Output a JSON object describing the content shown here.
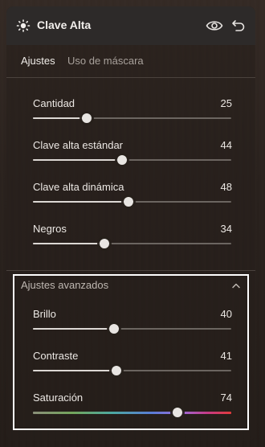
{
  "header": {
    "title": "Clave Alta",
    "icon": "sun-icon"
  },
  "tabs": [
    {
      "label": "Ajustes",
      "active": true
    },
    {
      "label": "Uso de máscara",
      "active": false
    }
  ],
  "sliders": [
    {
      "label": "Cantidad",
      "value": "25",
      "position": 0.27
    },
    {
      "label": "Clave alta estándar",
      "value": "44",
      "position": 0.45
    },
    {
      "label": "Clave alta dinámica",
      "value": "48",
      "position": 0.48
    },
    {
      "label": "Negros",
      "value": "34",
      "position": 0.36
    }
  ],
  "advanced": {
    "title": "Ajustes avanzados",
    "sliders": [
      {
        "label": "Brillo",
        "value": "40",
        "position": 0.41
      },
      {
        "label": "Contraste",
        "value": "41",
        "position": 0.42
      },
      {
        "label": "Saturación",
        "value": "74",
        "position": 0.73
      }
    ]
  },
  "colors": {
    "highlight_border": "#ffffff",
    "accent": "#e8e5e2"
  }
}
